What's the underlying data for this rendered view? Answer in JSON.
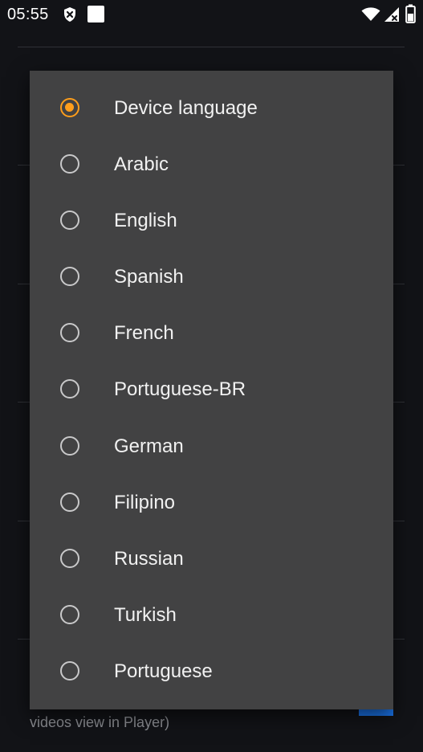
{
  "status_bar": {
    "time": "05:55",
    "icons": [
      "shield-x-icon",
      "square-notification-icon",
      "wifi-icon",
      "signal-icon",
      "battery-icon"
    ]
  },
  "background": {
    "footer_text": "videos view in Player)"
  },
  "dialog": {
    "selected_index": 0,
    "accent_color": "#ff9e1b",
    "options": [
      {
        "label": "Device language",
        "selected": true
      },
      {
        "label": "Arabic",
        "selected": false
      },
      {
        "label": "English",
        "selected": false
      },
      {
        "label": "Spanish",
        "selected": false
      },
      {
        "label": "French",
        "selected": false
      },
      {
        "label": "Portuguese-BR",
        "selected": false
      },
      {
        "label": "German",
        "selected": false
      },
      {
        "label": "Filipino",
        "selected": false
      },
      {
        "label": "Russian",
        "selected": false
      },
      {
        "label": "Turkish",
        "selected": false
      },
      {
        "label": "Portuguese",
        "selected": false
      }
    ]
  }
}
